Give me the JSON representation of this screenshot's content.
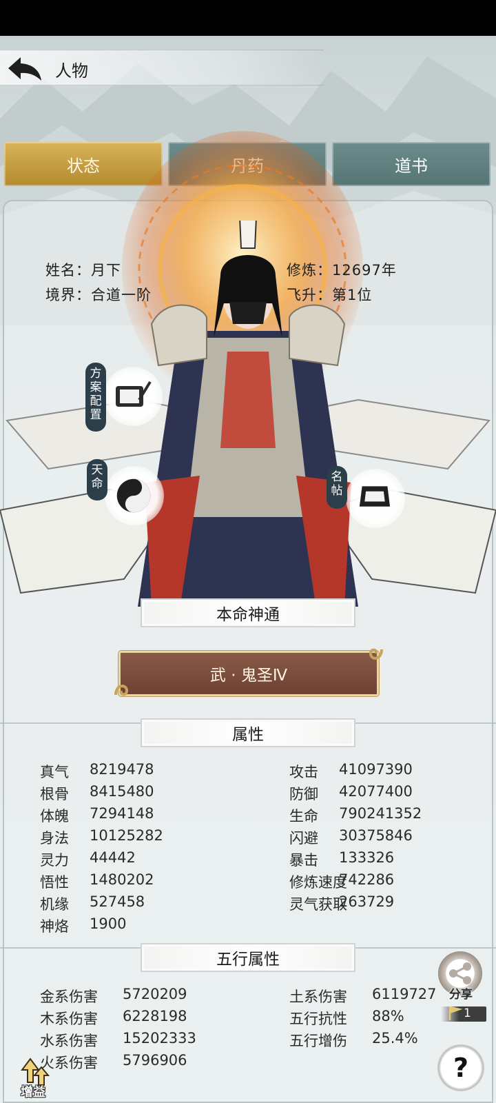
{
  "header": {
    "title": "人物"
  },
  "tabs": [
    {
      "label": "状态",
      "active": true
    },
    {
      "label": "丹药",
      "active": false
    },
    {
      "label": "道书",
      "active": false
    }
  ],
  "profile": {
    "name_label": "姓名：月下",
    "realm_label": "境界：合道一阶",
    "cultivation_label": "修炼：12697年",
    "ascension_label": "飞升：第1位"
  },
  "side_buttons": {
    "plan": "方案配置",
    "fate": "天命",
    "card": "名帖"
  },
  "skill": {
    "section_title": "本命神通",
    "name": "武 · 鬼圣Ⅳ"
  },
  "attributes": {
    "section_title": "属性",
    "left": [
      {
        "label": "真气",
        "value": "8219478"
      },
      {
        "label": "根骨",
        "value": "8415480"
      },
      {
        "label": "体魄",
        "value": "7294148"
      },
      {
        "label": "身法",
        "value": "10125282"
      },
      {
        "label": "灵力",
        "value": "44442"
      },
      {
        "label": "悟性",
        "value": "1480202"
      },
      {
        "label": "机缘",
        "value": "527458"
      },
      {
        "label": "神烙",
        "value": "1900"
      }
    ],
    "right": [
      {
        "label": "攻击",
        "value": "41097390"
      },
      {
        "label": "防御",
        "value": "42077400"
      },
      {
        "label": "生命",
        "value": "790241352"
      },
      {
        "label": "闪避",
        "value": "30375846"
      },
      {
        "label": "暴击",
        "value": "133326"
      },
      {
        "label": "修炼速度",
        "value": "742286"
      },
      {
        "label": "灵气获取",
        "value": "263729"
      }
    ]
  },
  "elements": {
    "section_title": "五行属性",
    "left": [
      {
        "label": "金系伤害",
        "value": "5720209"
      },
      {
        "label": "木系伤害",
        "value": "6228198"
      },
      {
        "label": "水系伤害",
        "value": "15202333"
      },
      {
        "label": "火系伤害",
        "value": "5796906"
      }
    ],
    "right": [
      {
        "label": "土系伤害",
        "value": "6119727"
      },
      {
        "label": "五行抗性",
        "value": "88%"
      },
      {
        "label": "五行增伤",
        "value": "25.4%"
      }
    ]
  },
  "floating": {
    "share_label": "分享",
    "share_count": "1",
    "help_label": "?",
    "boost_label": "增益"
  },
  "colors": {
    "tab_active": "#c9a043",
    "tab_inactive": "#5f7f7f",
    "skill_button": "#7b4c3c",
    "flame": "#f08a1c"
  }
}
